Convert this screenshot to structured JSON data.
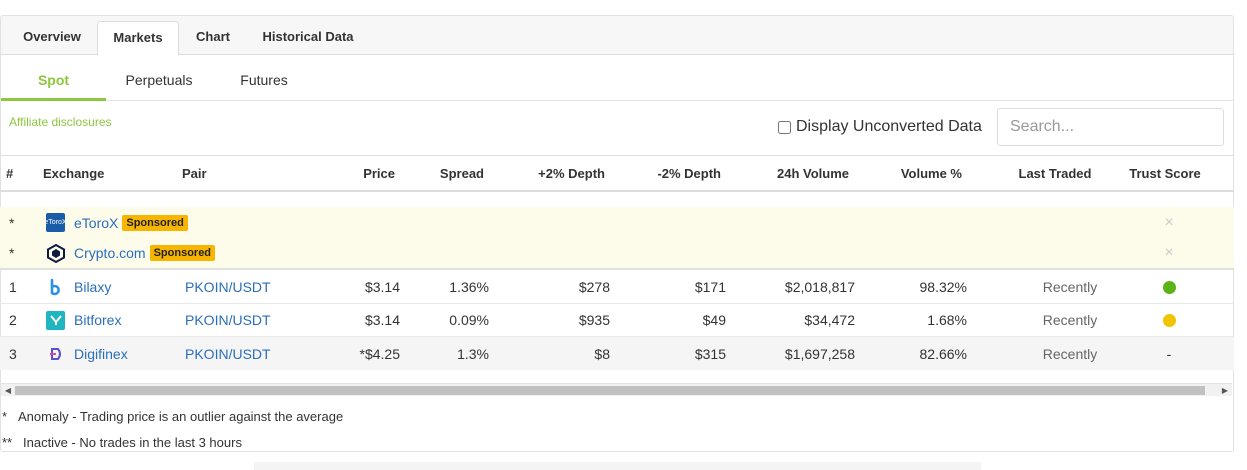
{
  "top_tabs": [
    {
      "label": "Overview",
      "active": false
    },
    {
      "label": "Markets",
      "active": true
    },
    {
      "label": "Chart",
      "active": false
    },
    {
      "label": "Historical Data",
      "active": false
    }
  ],
  "sub_tabs": [
    {
      "label": "Spot",
      "active": true
    },
    {
      "label": "Perpetuals",
      "active": false
    },
    {
      "label": "Futures",
      "active": false
    }
  ],
  "affiliate_link": "Affiliate disclosures",
  "unconverted_label": "Display Unconverted Data",
  "search": {
    "placeholder": "Search...",
    "value": ""
  },
  "table": {
    "headers": [
      "#",
      "Exchange",
      "Pair",
      "Price",
      "Spread",
      "+2% Depth",
      "-2% Depth",
      "24h Volume",
      "Volume %",
      "Last Traded",
      "Trust Score"
    ],
    "sponsored_rows": [
      {
        "rank": "*",
        "exchange": "eToroX",
        "badge": "Sponsored",
        "logo_icon": "etorox-logo-icon",
        "trust": "×"
      },
      {
        "rank": "*",
        "exchange": "Crypto.com",
        "badge": "Sponsored",
        "logo_icon": "cryptocom-logo-icon",
        "trust": "×"
      }
    ],
    "rows": [
      {
        "rank": "1",
        "exchange": "Bilaxy",
        "logo_icon": "bilaxy-logo-icon",
        "pair": "PKOIN/USDT",
        "price": "$3.14",
        "spread": "1.36%",
        "depth_plus": "$278",
        "depth_minus": "$171",
        "volume": "$2,018,817",
        "volume_pct": "98.32%",
        "last_traded": "Recently",
        "trust": "green"
      },
      {
        "rank": "2",
        "exchange": "Bitforex",
        "logo_icon": "bitforex-logo-icon",
        "pair": "PKOIN/USDT",
        "price": "$3.14",
        "spread": "0.09%",
        "depth_plus": "$935",
        "depth_minus": "$49",
        "volume": "$34,472",
        "volume_pct": "1.68%",
        "last_traded": "Recently",
        "trust": "yellow"
      },
      {
        "rank": "3",
        "exchange": "Digifinex",
        "logo_icon": "digifinex-logo-icon",
        "pair": "PKOIN/USDT",
        "price": "*$4.25",
        "spread": "1.3%",
        "depth_plus": "$8",
        "depth_minus": "$315",
        "volume": "$1,697,258",
        "volume_pct": "82.66%",
        "last_traded": "Recently",
        "trust": "-"
      }
    ]
  },
  "footnotes": [
    {
      "mark": "*",
      "text": "Anomaly - Trading price is an outlier against the average"
    },
    {
      "mark": "**",
      "text": "Inactive - No trades in the last 3 hours"
    }
  ],
  "colors": {
    "accent": "#8dc63f",
    "link": "#2a6ebb",
    "badge": "#f7b500",
    "trust_green": "#5bb318",
    "trust_yellow": "#f2c300"
  }
}
